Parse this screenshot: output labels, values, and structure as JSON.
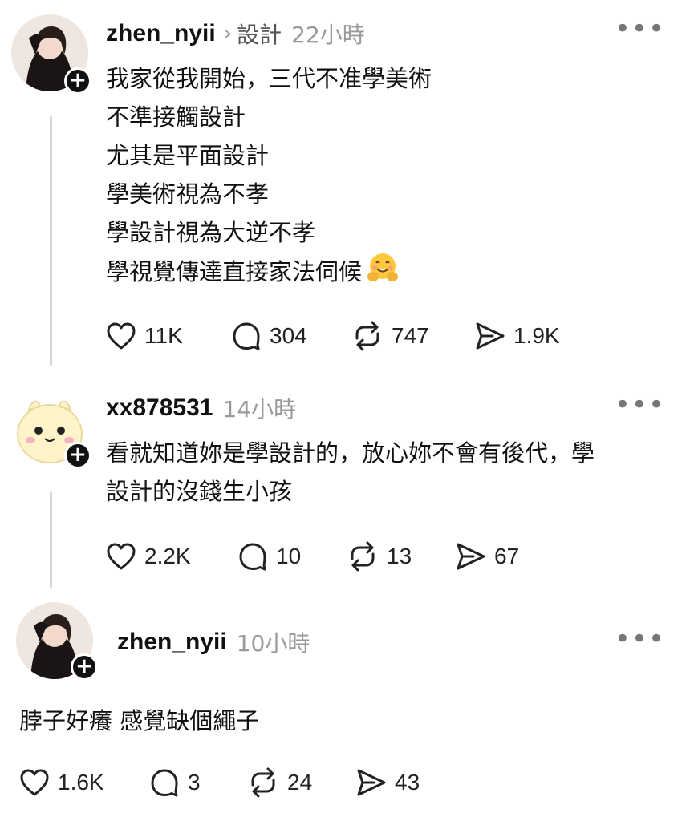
{
  "posts": [
    {
      "username": "zhen_nyii",
      "topic": "設計",
      "time": "22小時",
      "lines": [
        "我家從我開始，三代不准學美術",
        "不準接觸設計",
        "尤其是平面設計",
        "學美術視為不孝",
        "學設計視為大逆不孝",
        "學視覺傳達直接家法伺候"
      ],
      "emoji": "hugging-face-emoji",
      "stats": {
        "likes": "11K",
        "comments": "304",
        "reposts": "747",
        "shares": "1.9K"
      }
    },
    {
      "username": "xx878531",
      "time": "14小時",
      "lines": [
        "看就知道妳是學設計的，放心妳不會有後代，學",
        "設計的沒錢生小孩"
      ],
      "stats": {
        "likes": "2.2K",
        "comments": "10",
        "reposts": "13",
        "shares": "67"
      }
    },
    {
      "username": "zhen_nyii",
      "time": "10小時",
      "lines": [
        "脖子好癢 感覺缺個繩子"
      ],
      "stats": {
        "likes": "1.6K",
        "comments": "3",
        "reposts": "24",
        "shares": "43"
      }
    }
  ],
  "icons": {
    "like": "heart-icon",
    "comment": "comment-bubble-icon",
    "repost": "repost-arrows-icon",
    "share": "send-icon",
    "more": "more-dots-icon",
    "follow": "plus-icon"
  },
  "colors": {
    "text": "#111111",
    "muted": "#9a9a9a",
    "thread_line": "#d6d6d6"
  }
}
